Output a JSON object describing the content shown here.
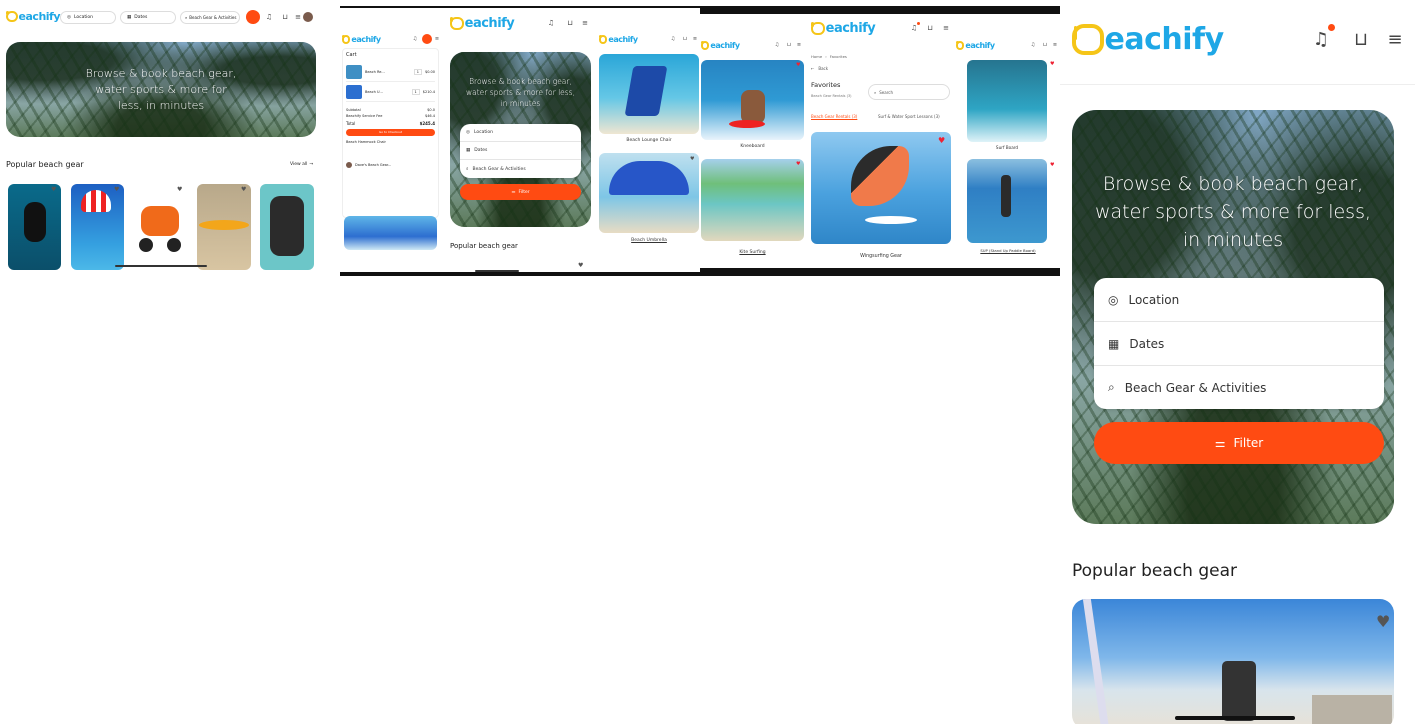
{
  "brand": {
    "name": "eachify",
    "accent": "#ff4b12",
    "blue": "#1ea7e6",
    "yellow": "#f5c518"
  },
  "hero_text": "Browse & book beach gear, water sports & more for less, in minutes",
  "search": {
    "location": "Location",
    "dates": "Dates",
    "gear": "Beach Gear & Activities",
    "filter": "Filter"
  },
  "section": {
    "popular": "Popular beach gear",
    "view_all": "View all"
  },
  "panel1": {
    "products": [
      "scuba-diving",
      "parasailing",
      "scooter",
      "kayak",
      "car-seat"
    ]
  },
  "cart": {
    "title": "Cart",
    "items": [
      {
        "name": "Beach Re...",
        "price": "$0.00",
        "qty": "1"
      },
      {
        "name": "Beach U...",
        "price": "$210.4",
        "qty": "1"
      }
    ],
    "subtotal_label": "Subtotal",
    "subtotal": "$0.0",
    "fee_label": "Beachify Service Fee",
    "fee": "$46.4",
    "total_label": "Total",
    "total": "$245.4",
    "checkout": "Go to Checkout",
    "extra_label": "Beach Hammock Chair",
    "vendor": "Dave's Beach Gear..."
  },
  "panel2": {
    "items": [
      {
        "label": "Beach Lounge Chair"
      },
      {
        "label": "Beach Umbrella"
      }
    ]
  },
  "favorites": {
    "breadcrumb_home": "Home",
    "breadcrumb_current": "Favorites",
    "back": "Back",
    "title": "Favorites",
    "subtitle": "Beach Gear Rentals (3)",
    "search": "Search",
    "tab1": "Beach Gear Rentals (3)",
    "tab2": "Surf & Water Sport Lessons (3)",
    "left_items": [
      "Kneeboard",
      "Kite Surfing"
    ],
    "center_item": "Wingsurfing Gear",
    "right_items": [
      "Surf Board",
      "SUP (Stand Up Paddle Board)"
    ]
  }
}
